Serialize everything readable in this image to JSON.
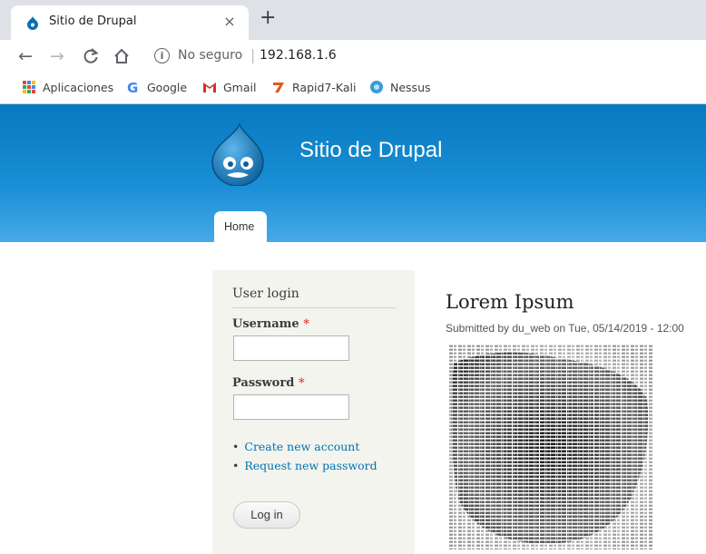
{
  "browser": {
    "tab_title": "Sitio de Drupal",
    "tab_close": "×",
    "new_tab": "+",
    "security_label": "No seguro",
    "url": "192.168.1.6",
    "bookmarks": [
      {
        "label": "Aplicaciones",
        "icon": "apps-grid-icon"
      },
      {
        "label": "Google",
        "icon": "google-icon"
      },
      {
        "label": "Gmail",
        "icon": "gmail-icon"
      },
      {
        "label": "Rapid7-Kali",
        "icon": "rapid7-icon"
      },
      {
        "label": "Nessus",
        "icon": "nessus-icon"
      }
    ]
  },
  "site": {
    "name": "Sitio de Drupal",
    "nav": {
      "home": "Home"
    },
    "brand_color": "#0779bf"
  },
  "login": {
    "title": "User login",
    "username_label": "Username",
    "password_label": "Password",
    "required_mark": "*",
    "links": [
      "Create new account",
      "Request new password"
    ],
    "button": "Log in"
  },
  "node": {
    "title": "Lorem Ipsum",
    "submitted": "Submitted by du_web on Tue, 05/14/2019 - 12:00"
  }
}
